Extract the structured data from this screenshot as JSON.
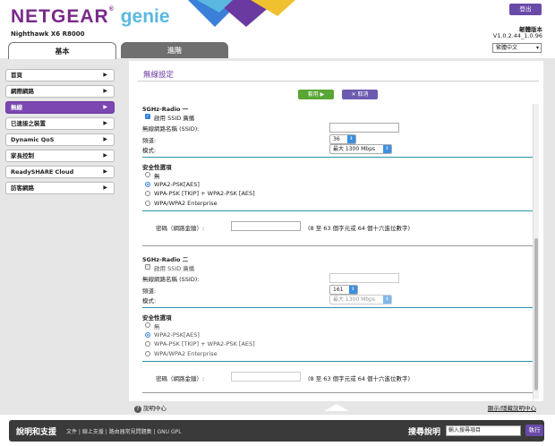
{
  "header": {
    "brand": "NETGEAR",
    "product": "genie",
    "model": "Nighthawk X6 R8000",
    "logout": "登出",
    "firmware_label": "韌體版本",
    "firmware_version": "V1.0.2.44_1.0.96",
    "language": "繁體中文"
  },
  "tabs": {
    "basic": "基本",
    "advanced": "進階"
  },
  "sidebar": {
    "items": [
      {
        "label": "首頁"
      },
      {
        "label": "網際網路"
      },
      {
        "label": "無線"
      },
      {
        "label": "已連接之裝置"
      },
      {
        "label": "Dynamic QoS"
      },
      {
        "label": "家長控制"
      },
      {
        "label": "ReadySHARE Cloud"
      },
      {
        "label": "訪客網路"
      }
    ],
    "active_index": 2
  },
  "page": {
    "title": "無線設定",
    "apply": "套用 ▶",
    "cancel": "✕ 取消"
  },
  "radio1": {
    "heading": "5GHz-Radio 一",
    "ssid_broadcast": "啟用 SSID 廣播",
    "ssid_label": "無線網路名稱 (SSID):",
    "ssid_value": "",
    "channel_label": "頻道:",
    "channel_value": "36",
    "mode_label": "模式:",
    "mode_value": "最大 1300 Mbps",
    "security_heading": "安全性選項",
    "security_options": [
      "無",
      "WPA2-PSK[AES]",
      "WPA-PSK [TKIP] + WPA2-PSK [AES]",
      "WPA/WPA2 Enterprise"
    ],
    "security_selected": 1,
    "password_label": "密碼（網路金鑰）:",
    "password_hint": "(8 至 63 個字元或 64 個十六進位數字)"
  },
  "radio2": {
    "heading": "5GHz-Radio 二",
    "ssid_broadcast": "啟用 SSID 廣播",
    "ssid_label": "無線網路名稱 (SSID):",
    "ssid_value": "",
    "channel_label": "頻道:",
    "channel_value": "161",
    "mode_label": "模式:",
    "mode_value": "最大 1300 Mbps",
    "security_heading": "安全性選項",
    "security_options": [
      "無",
      "WPA2-PSK[AES]",
      "WPA-PSK [TKIP] + WPA2-PSK [AES]",
      "WPA/WPA2 Enterprise"
    ],
    "security_selected": 1,
    "password_label": "密碼（網路金鑰）:",
    "password_hint": "(8 至 63 個字元或 64 個十六進位數字)"
  },
  "help": {
    "center": "說明中心",
    "toggle": "顯示/隱藏說明中心"
  },
  "footer": {
    "title": "說明和支援",
    "links": "文件 | 線上支援 | 路由器常見問題集 | GNU GPL",
    "search_label": "搜尋說明",
    "search_placeholder": "輸入搜尋項目",
    "search_button": "執行"
  },
  "colors": {
    "brand_purple": "#7a2a8a",
    "genie_blue": "#5bb8e0",
    "active_nav": "#7a48b0",
    "apply_green": "#5aa635",
    "cancel_purple": "#6d5bb0",
    "section_rule": "#2a93a8"
  }
}
